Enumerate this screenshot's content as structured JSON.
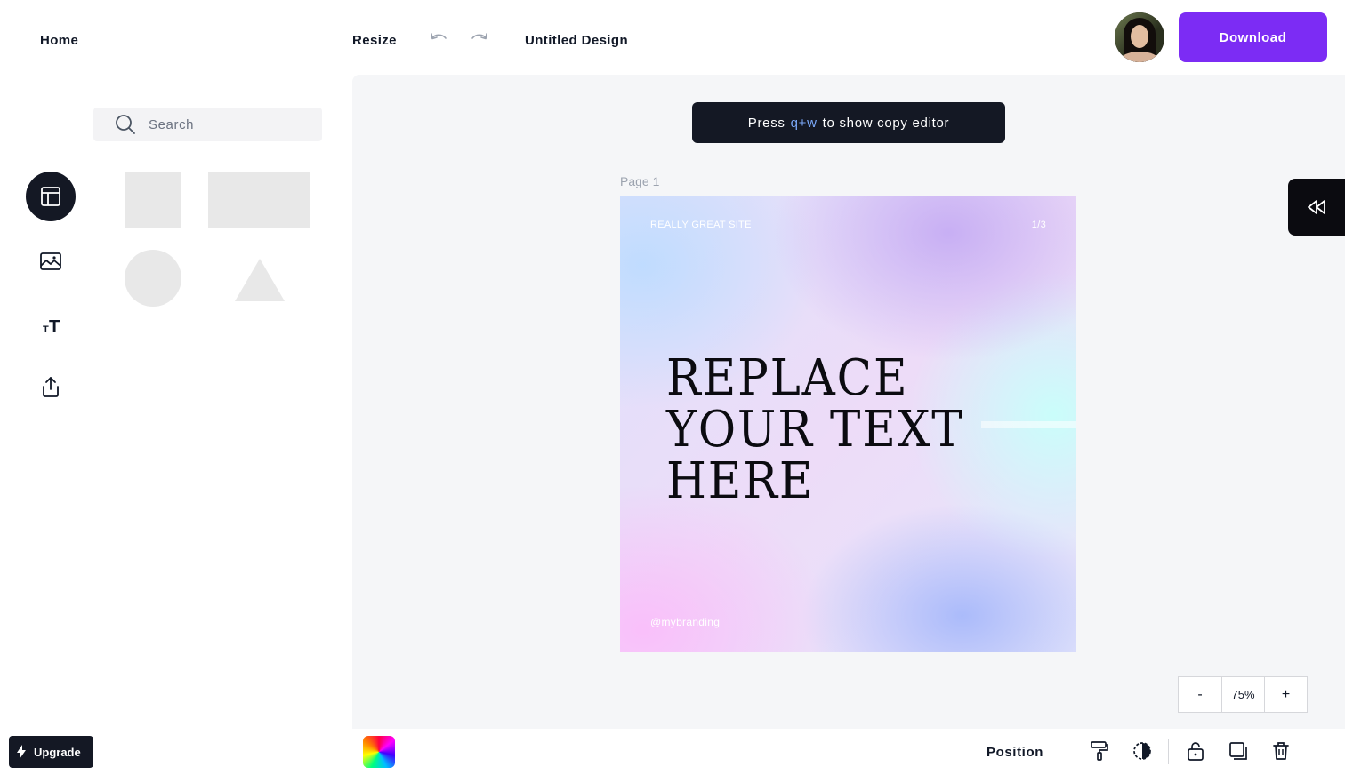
{
  "header": {
    "home": "Home",
    "resize": "Resize",
    "title": "Untitled Design",
    "download": "Download"
  },
  "sidebar": {
    "search_placeholder": "Search",
    "rail_icons": [
      "layout-icon",
      "image-icon",
      "text-icon",
      "upload-icon"
    ],
    "upgrade": "Upgrade"
  },
  "hint": {
    "prefix": "Press",
    "key": "q+w",
    "suffix": "to show copy editor"
  },
  "page": {
    "label": "Page 1"
  },
  "canvas": {
    "site": "REALLY GREAT SITE",
    "counter": "1/3",
    "headline_line1": "REPLACE",
    "headline_line2": "YOUR TEXT",
    "headline_line3": "HERE",
    "handle": "@mybranding"
  },
  "zoom": {
    "minus": "-",
    "level": "75%",
    "plus": "+"
  },
  "toolbar": {
    "position": "Position"
  },
  "colors": {
    "accent": "#7c2cf4",
    "dark": "#141824",
    "hint_key": "#7aa7f7"
  }
}
